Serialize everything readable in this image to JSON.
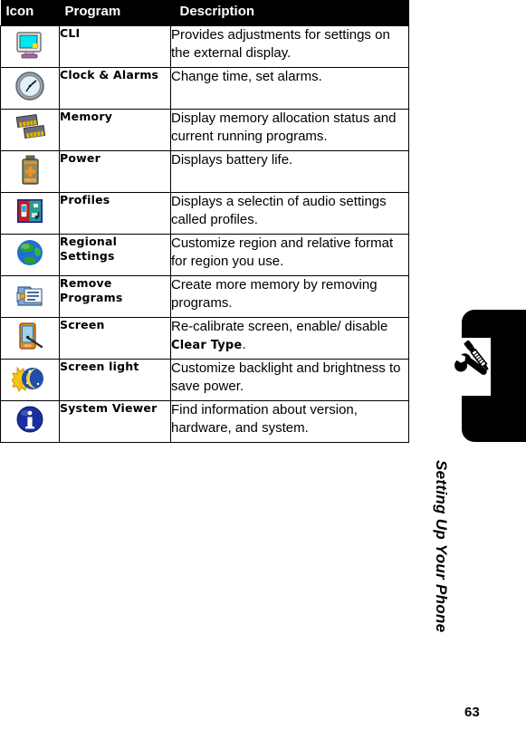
{
  "page": {
    "number": "63",
    "chapter_label": "Setting Up Your Phone",
    "chapter_icon": "wrench-screwdriver-icon"
  },
  "table": {
    "name": "settings-programs-table",
    "headers": {
      "icon": "Icon",
      "program": "Program",
      "description": "Description"
    },
    "header_background": "#000000",
    "header_text_color": "#ffffff",
    "border_color": "#000000",
    "rows": [
      {
        "icon": "external-display-monitor-icon",
        "program": "CLI",
        "description": "Provides adjustments for settings on the external display."
      },
      {
        "icon": "clock-alarm-icon",
        "program": "Clock & Alarms",
        "description": "Change time, set alarms."
      },
      {
        "icon": "memory-chips-icon",
        "program": "Memory",
        "description": "Display memory allocation status and current running programs."
      },
      {
        "icon": "battery-power-icon",
        "program": "Power",
        "description": "Displays battery life."
      },
      {
        "icon": "profiles-audio-icon",
        "program": "Profiles",
        "description": "Displays a selectin of audio settings called profiles."
      },
      {
        "icon": "globe-regional-settings-icon",
        "program": "Regional Settings",
        "description": "Customize region and relative format for region you use."
      },
      {
        "icon": "remove-programs-icon",
        "program": "Remove Programs",
        "description": "Create more memory by removing programs."
      },
      {
        "icon": "screen-stylus-icon",
        "program": "Screen",
        "description_pre": "Re-calibrate screen, enable/ disable ",
        "description_bold": "Clear Type",
        "description_post": "."
      },
      {
        "icon": "screen-light-sun-moon-icon",
        "program": "Screen light",
        "description": "Customize backlight and brightness to save power."
      },
      {
        "icon": "system-viewer-info-icon",
        "program": "System Viewer",
        "description": "Find information about version, hardware, and system."
      }
    ]
  }
}
